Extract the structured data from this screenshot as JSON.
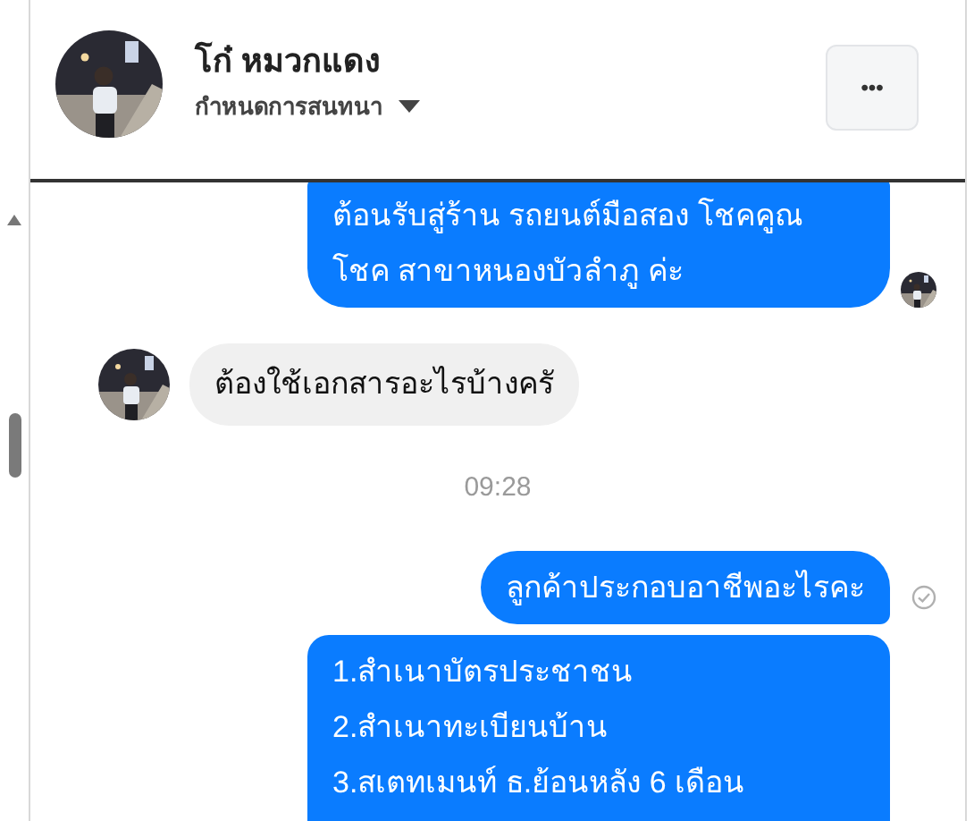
{
  "header": {
    "name": "โก๋ หมวกแดง",
    "subtitle": "กำหนดการสนทนา",
    "more_button": "•••"
  },
  "messages": [
    {
      "kind": "outgoing",
      "text": "ต้อนรับสู่ร้าน รถยนต์มือสอง โชคคูณ\nโชค สาขาหนองบัวลำภู ค่ะ",
      "seen": true,
      "sent": false
    },
    {
      "kind": "incoming",
      "text": "ต้องใช้เอกสารอะไรบ้างครั"
    },
    {
      "kind": "time",
      "text": "09:28"
    },
    {
      "kind": "outgoing",
      "text": "ลูกค้าประกอบอาชีพอะไรคะ",
      "seen": false,
      "sent": true
    },
    {
      "kind": "outgoing",
      "text": "1.สำเนาบัตรประชาชน\n2.สำเนาทะเบียนบ้าน\n3.สเตทเมนท์ ธ.ย้อนหลัง 6 เดือน",
      "seen": false,
      "sent": false
    }
  ]
}
